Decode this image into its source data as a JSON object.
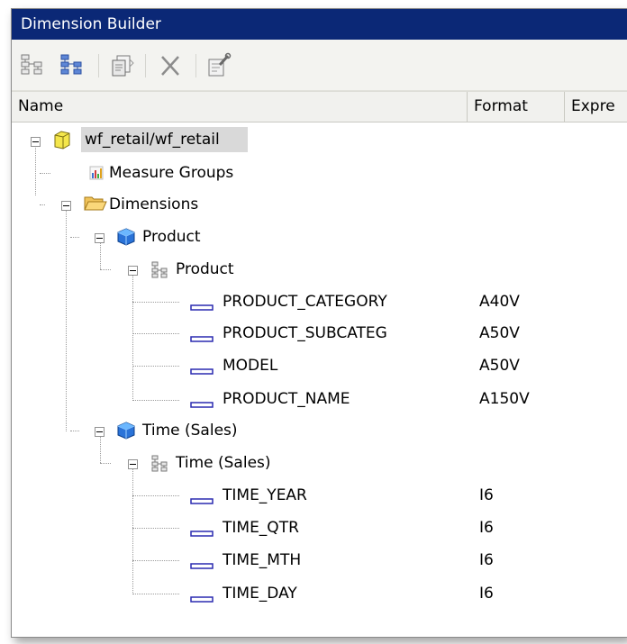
{
  "window": {
    "title": "Dimension Builder"
  },
  "toolbar": {
    "buttons": [
      {
        "icon": "add-hierarchy-icon"
      },
      {
        "icon": "add-level-icon"
      },
      {
        "icon": "copy-icon"
      },
      {
        "icon": "delete-icon"
      },
      {
        "icon": "properties-icon"
      }
    ]
  },
  "columns": {
    "name": "Name",
    "format": "Format",
    "expression": "Expre"
  },
  "tree": {
    "root": {
      "label": "wf_retail/wf_retail"
    },
    "measure_groups": {
      "label": "Measure Groups"
    },
    "dimensions": {
      "label": "Dimensions"
    },
    "product_dim": {
      "label": "Product",
      "hierarchy": {
        "label": "Product"
      },
      "fields": [
        {
          "label": "PRODUCT_CATEGORY",
          "format": "A40V"
        },
        {
          "label": "PRODUCT_SUBCATEG",
          "format": "A50V"
        },
        {
          "label": "MODEL",
          "format": "A50V"
        },
        {
          "label": "PRODUCT_NAME",
          "format": "A150V"
        }
      ]
    },
    "time_dim": {
      "label": "Time (Sales)",
      "hierarchy": {
        "label": "Time (Sales)"
      },
      "fields": [
        {
          "label": "TIME_YEAR",
          "format": "I6"
        },
        {
          "label": "TIME_QTR",
          "format": "I6"
        },
        {
          "label": "TIME_MTH",
          "format": "I6"
        },
        {
          "label": "TIME_DAY",
          "format": "I6"
        }
      ]
    }
  }
}
